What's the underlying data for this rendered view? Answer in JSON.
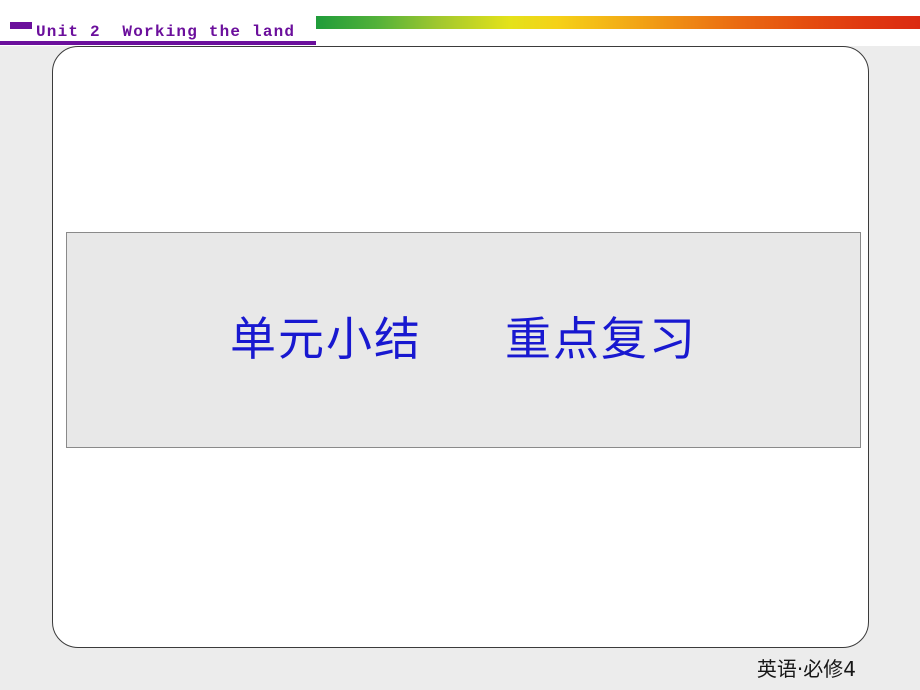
{
  "slide": {
    "header": {
      "title": "Unit 2  Working the land",
      "accent_color": "#6b0f9c",
      "rainbow_colors": [
        "#1f9c3a",
        "#9fc72f",
        "#e4e21a",
        "#f3b016",
        "#ea6a12",
        "#db2a12"
      ]
    },
    "body": {
      "title_box_text": "单元小结     重点复习",
      "title_color": "#1818d0",
      "box_fill": "#e8e8e8",
      "box_border": "#8a8a8a"
    },
    "footer": {
      "text": "英语·必修4"
    }
  }
}
